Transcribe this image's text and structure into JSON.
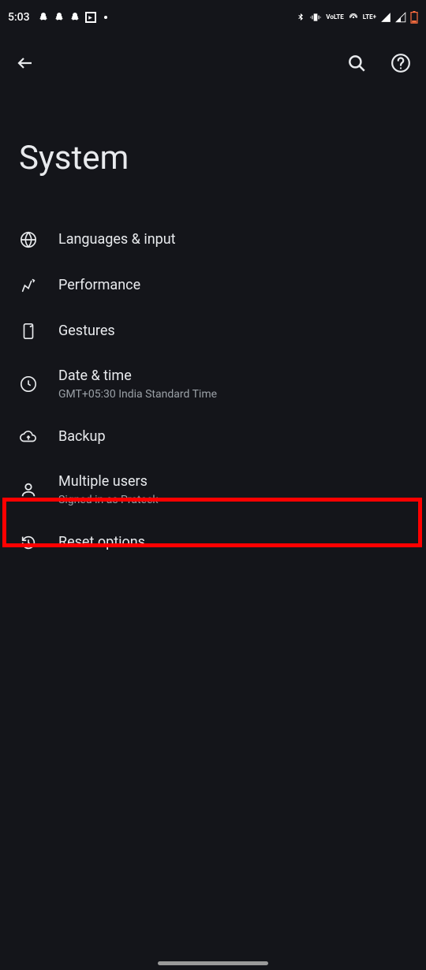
{
  "status_bar": {
    "time": "5:03",
    "lte": "LTE+",
    "volte": "VoLTE"
  },
  "app_bar": {},
  "page": {
    "title": "System"
  },
  "items": [
    {
      "title": "Languages & input",
      "subtitle": ""
    },
    {
      "title": "Performance",
      "subtitle": ""
    },
    {
      "title": "Gestures",
      "subtitle": ""
    },
    {
      "title": "Date & time",
      "subtitle": "GMT+05:30 India Standard Time"
    },
    {
      "title": "Backup",
      "subtitle": ""
    },
    {
      "title": "Multiple users",
      "subtitle": "Signed in as Prateek"
    },
    {
      "title": "Reset options",
      "subtitle": ""
    }
  ]
}
